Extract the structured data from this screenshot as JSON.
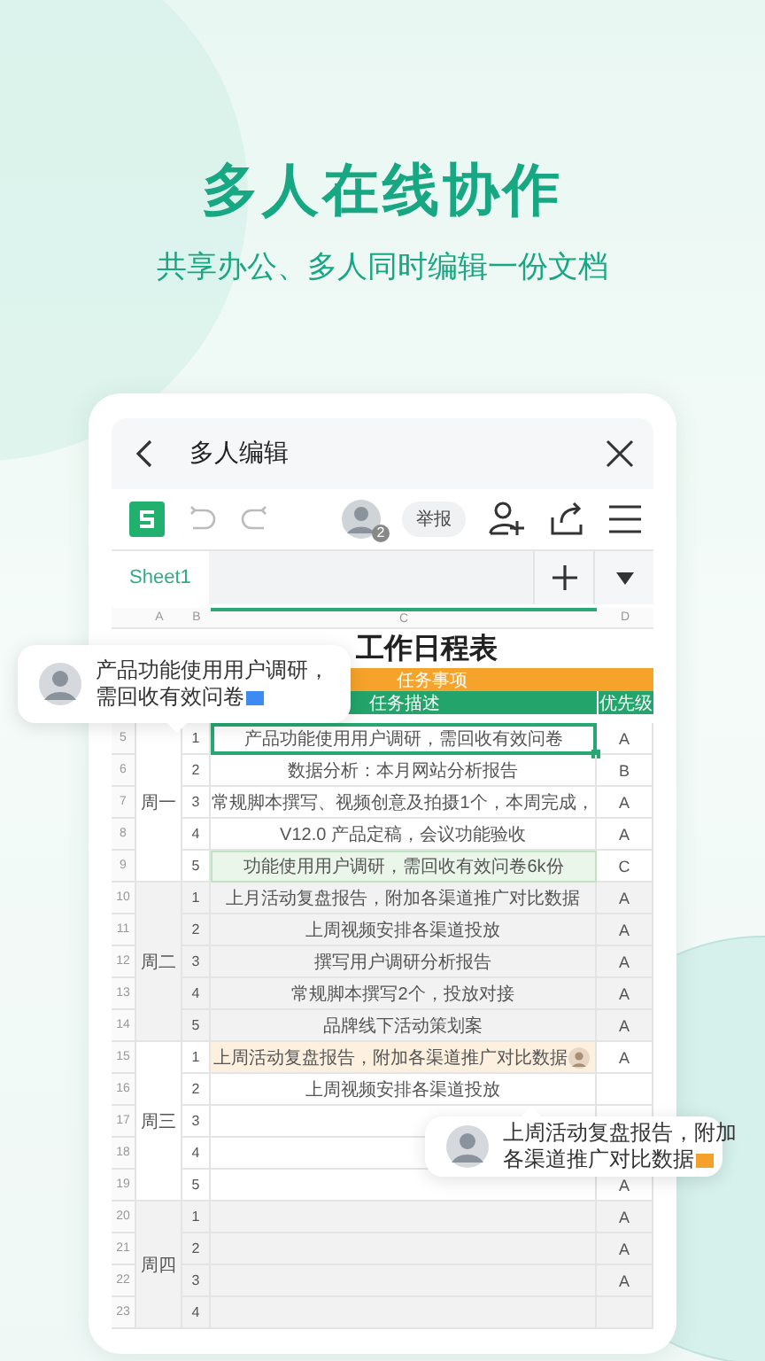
{
  "headline": "多人在线协作",
  "subtitle": "共享办公、多人同时编辑一份文档",
  "nav": {
    "title": "多人编辑"
  },
  "toolbar": {
    "collaborator_count": "2",
    "report_button": "举报"
  },
  "sheet_tabs": [
    {
      "label": "Sheet1",
      "selected": true
    }
  ],
  "grid": {
    "columns": [
      {
        "label": "A",
        "selected": false
      },
      {
        "label": "B",
        "selected": false
      },
      {
        "label": "C",
        "selected": true
      },
      {
        "label": "D",
        "selected": false
      }
    ],
    "title": "工作日程表",
    "section_header": "任务事项",
    "headers": [
      "任务描述",
      "优先级"
    ],
    "groups": [
      {
        "day": "周一",
        "shaded": false,
        "rows": [
          {
            "row": "5",
            "index": "1",
            "task": "产品功能使用用户调研，需回收有效问卷",
            "priority": "A",
            "selected": true,
            "marked": false,
            "editing": false
          },
          {
            "row": "6",
            "index": "2",
            "task": "数据分析：本月网站分析报告",
            "priority": "B",
            "selected": false,
            "marked": false,
            "editing": false
          },
          {
            "row": "7",
            "index": "3",
            "task": "常规脚本撰写、视频创意及拍摄1个，本周完成，",
            "priority": "A",
            "selected": false,
            "marked": false,
            "editing": false
          },
          {
            "row": "8",
            "index": "4",
            "task": "V12.0 产品定稿，会议功能验收",
            "priority": "A",
            "selected": false,
            "marked": false,
            "editing": false
          },
          {
            "row": "9",
            "index": "5",
            "task": "功能使用用户调研，需回收有效问卷6k份",
            "priority": "C",
            "selected": false,
            "marked": true,
            "editing": false
          }
        ]
      },
      {
        "day": "周二",
        "shaded": true,
        "rows": [
          {
            "row": "10",
            "index": "1",
            "task": "上月活动复盘报告，附加各渠道推广对比数据",
            "priority": "A",
            "selected": false,
            "marked": false,
            "editing": false
          },
          {
            "row": "11",
            "index": "2",
            "task": "上周视频安排各渠道投放",
            "priority": "A",
            "selected": false,
            "marked": false,
            "editing": false
          },
          {
            "row": "12",
            "index": "3",
            "task": "撰写用户调研分析报告",
            "priority": "A",
            "selected": false,
            "marked": false,
            "editing": false
          },
          {
            "row": "13",
            "index": "4",
            "task": "常规脚本撰写2个，投放对接",
            "priority": "A",
            "selected": false,
            "marked": false,
            "editing": false
          },
          {
            "row": "14",
            "index": "5",
            "task": "品牌线下活动策划案",
            "priority": "A",
            "selected": false,
            "marked": false,
            "editing": false
          }
        ]
      },
      {
        "day": "周三",
        "shaded": false,
        "rows": [
          {
            "row": "15",
            "index": "1",
            "task": "上周活动复盘报告，附加各渠道推广对比数据",
            "priority": "A",
            "selected": false,
            "marked": false,
            "editing": true
          },
          {
            "row": "16",
            "index": "2",
            "task": "上周视频安排各渠道投放",
            "selected": false,
            "marked": false,
            "editing": false
          },
          {
            "row": "17",
            "index": "3",
            "selected": false,
            "marked": false,
            "editing": false
          },
          {
            "row": "18",
            "index": "4",
            "selected": false,
            "marked": false,
            "editing": false
          },
          {
            "row": "19",
            "index": "5",
            "priority": "A",
            "selected": false,
            "marked": false,
            "editing": false
          }
        ]
      },
      {
        "day": "周四",
        "shaded": true,
        "rows": [
          {
            "row": "20",
            "index": "1",
            "priority": "A",
            "selected": false,
            "marked": false,
            "editing": false
          },
          {
            "row": "21",
            "index": "2",
            "priority": "A",
            "selected": false,
            "marked": false,
            "editing": false
          },
          {
            "row": "22",
            "index": "3",
            "priority": "A",
            "selected": false,
            "marked": false,
            "editing": false
          },
          {
            "row": "23",
            "index": "4",
            "selected": false,
            "marked": false,
            "editing": false
          }
        ]
      }
    ]
  },
  "comments": [
    {
      "lines": [
        "产品功能使用用户调研，",
        "需回收有效问卷"
      ],
      "color": "#3d8bf2"
    },
    {
      "lines": [
        "上周活动复盘报告，附加",
        "各渠道推广对比数据"
      ],
      "color": "#f5a02a"
    }
  ]
}
